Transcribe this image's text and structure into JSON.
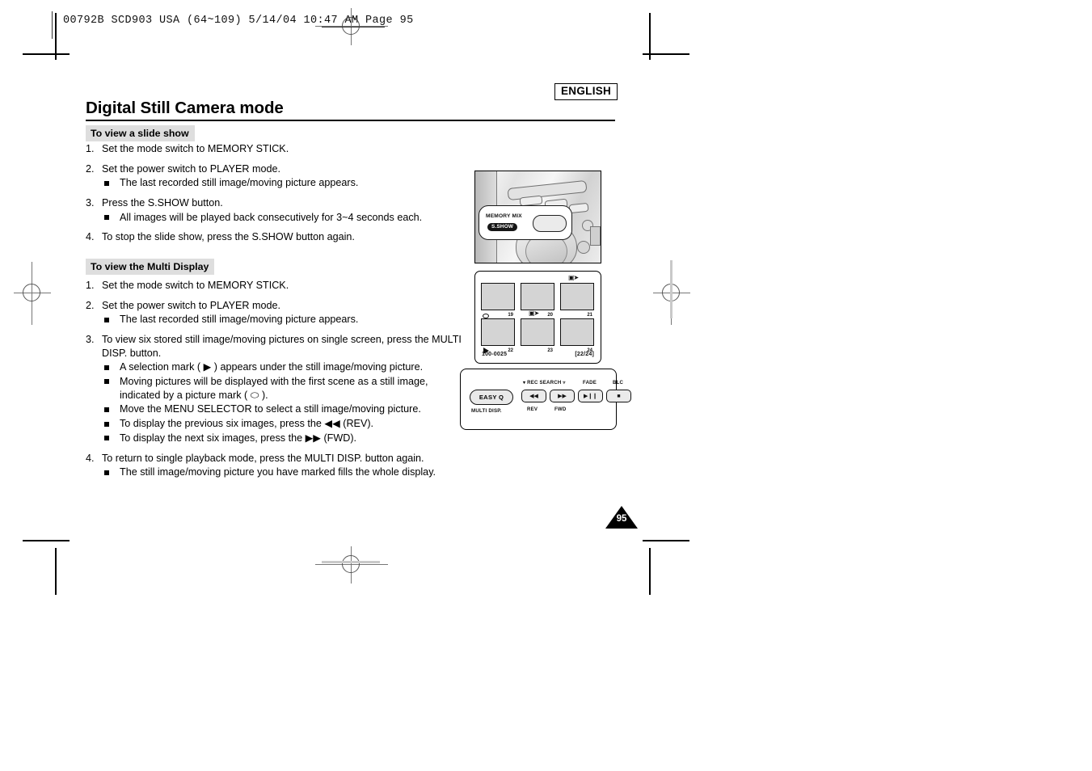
{
  "slug": {
    "text": "00792B SCD903 USA (64~109)   5/14/04 10:47 AM   Page 95"
  },
  "header": {
    "language_badge": "ENGLISH",
    "title": "Digital Still Camera mode"
  },
  "sections": [
    {
      "heading": "To view a slide show",
      "steps": [
        {
          "num": "1.",
          "text": "Set the mode switch to MEMORY STICK.",
          "bullets": []
        },
        {
          "num": "2.",
          "text": "Set the power switch to PLAYER mode.",
          "bullets": [
            "The last recorded still image/moving picture appears."
          ]
        },
        {
          "num": "3.",
          "text": "Press the S.SHOW button.",
          "bullets": [
            "All images will be played back consecutively for 3~4 seconds each."
          ]
        },
        {
          "num": "4.",
          "text": "To stop the slide show, press the S.SHOW button again.",
          "bullets": []
        }
      ]
    },
    {
      "heading": "To view the Multi Display",
      "steps": [
        {
          "num": "1.",
          "text": "Set the mode switch to MEMORY STICK.",
          "bullets": []
        },
        {
          "num": "2.",
          "text": "Set the power switch to PLAYER mode.",
          "bullets": [
            "The last recorded still image/moving picture appears."
          ]
        },
        {
          "num": "3.",
          "text": "To view six stored still image/moving pictures on single screen, press the MULTI DISP. button.",
          "bullets": [
            "A selection mark ( ▶ ) appears under the still image/moving picture.",
            "Moving pictures will be displayed with the first scene as a still image, indicated by a picture mark ( ⬭ ).",
            "Move the MENU SELECTOR to select a still image/moving picture.",
            "To display the previous six images, press the ◀◀ (REV).",
            "To display the next six images, press the ▶▶ (FWD)."
          ]
        },
        {
          "num": "4.",
          "text": "To return to single playback mode, press the MULTI DISP. button again.",
          "bullets": [
            "The still image/moving picture you have marked fills the whole display."
          ]
        }
      ]
    }
  ],
  "figures": {
    "camera": {
      "callout_label": "MEMORY MIX",
      "callout_badge": "S.SHOW"
    },
    "multi_display": {
      "thumbnails": [
        {
          "number": "19",
          "mark": "picture"
        },
        {
          "number": "20",
          "mark": "none"
        },
        {
          "number": "21",
          "mark": "movie"
        },
        {
          "number": "22",
          "mark": "play"
        },
        {
          "number": "23",
          "mark": "movie"
        },
        {
          "number": "24",
          "mark": "none"
        }
      ],
      "file_label": "100-0025",
      "counter_label": "[22/24]"
    },
    "button_panel": {
      "easy_button": "EASY Q",
      "easy_sub_label": "MULTI DISP.",
      "rec_search_label": "REC SEARCH",
      "buttons": [
        {
          "glyph": "◀◀",
          "label": "REV"
        },
        {
          "glyph": "▶▶",
          "label": "FWD"
        },
        {
          "glyph": "▶❙❙",
          "label": "FADE"
        },
        {
          "glyph": "■",
          "label": "BLC"
        }
      ]
    }
  },
  "page_number": "95",
  "colors": {
    "section_head_bg": "#dedede",
    "rule": "#000000",
    "page_badge_bg": "#000000",
    "page_badge_text": "#ffffff"
  }
}
